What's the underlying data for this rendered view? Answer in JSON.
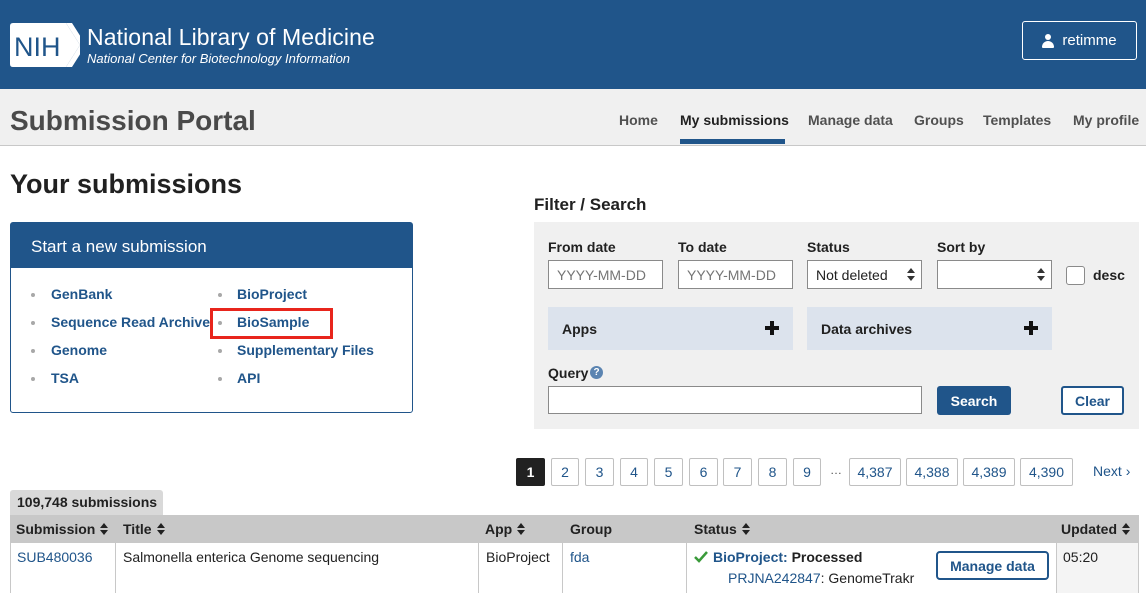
{
  "header": {
    "logo_text": "NIH",
    "org_title": "National Library of Medicine",
    "org_subtitle": "National Center for Biotechnology Information",
    "user": "retimme"
  },
  "portal": {
    "title": "Submission Portal",
    "nav": [
      {
        "label": "Home",
        "active": false
      },
      {
        "label": "My submissions",
        "active": true
      },
      {
        "label": "Manage data",
        "active": false
      },
      {
        "label": "Groups",
        "active": false
      },
      {
        "label": "Templates",
        "active": false
      },
      {
        "label": "My profile",
        "active": false
      }
    ]
  },
  "page_title": "Your submissions",
  "start_box": {
    "title": "Start a new submission",
    "links": [
      "GenBank",
      "Sequence Read Archive",
      "Genome",
      "TSA",
      "BioProject",
      "BioSample",
      "Supplementary Files",
      "API"
    ]
  },
  "filter": {
    "title": "Filter / Search",
    "from_label": "From date",
    "from_placeholder": "YYYY-MM-DD",
    "to_label": "To date",
    "to_placeholder": "YYYY-MM-DD",
    "status_label": "Status",
    "status_value": "Not deleted",
    "sort_label": "Sort by",
    "sort_value": "",
    "desc_label": "desc",
    "apps_label": "Apps",
    "archives_label": "Data archives",
    "query_label": "Query",
    "help_glyph": "?",
    "search_label": "Search",
    "clear_label": "Clear"
  },
  "pagination": {
    "pages": [
      "1",
      "2",
      "3",
      "4",
      "5",
      "6",
      "7",
      "8",
      "9"
    ],
    "ellipsis": "…",
    "last_pages": [
      "4,387",
      "4,388",
      "4,389",
      "4,390"
    ],
    "next_label": "Next",
    "next_glyph": "›"
  },
  "table": {
    "count_label": "109,748 submissions",
    "columns": [
      "Submission",
      "Title",
      "App",
      "Group",
      "Status",
      "Updated"
    ],
    "rows": [
      {
        "submission": "SUB480036",
        "title": "Salmonella enterica Genome sequencing",
        "app": "BioProject",
        "group": "fda",
        "status_app": "BioProject:",
        "status_value": "Processed",
        "accession": "PRJNA242847",
        "accession_note": ": GenomeTrakr",
        "action": "Manage data",
        "updated": "05:20"
      }
    ]
  },
  "colors": {
    "brand": "#20558a",
    "highlight": "#e8251c",
    "success": "#3a9a3a"
  }
}
